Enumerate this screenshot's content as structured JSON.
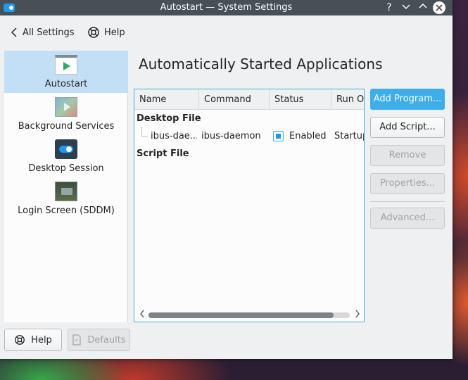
{
  "window": {
    "title": "Autostart  — System Settings",
    "buttons": {
      "help": "?",
      "minimize": "⌄",
      "maximize": "⌃",
      "close": "✕"
    }
  },
  "toolbar": {
    "back_label": "All Settings",
    "help_label": "Help"
  },
  "sidebar": {
    "items": [
      {
        "label": "Autostart",
        "icon": "autostart-icon",
        "selected": true
      },
      {
        "label": "Background Services",
        "icon": "background-services-icon",
        "selected": false
      },
      {
        "label": "Desktop Session",
        "icon": "desktop-session-icon",
        "selected": false
      },
      {
        "label": "Login Screen (SDDM)",
        "icon": "login-screen-icon",
        "selected": false
      }
    ]
  },
  "main": {
    "title": "Automatically Started Applications",
    "table": {
      "columns": [
        "Name",
        "Command",
        "Status",
        "Run On"
      ],
      "groups": [
        {
          "label": "Desktop File",
          "rows": [
            {
              "name": "ibus-dae...",
              "command": "ibus-daemon",
              "status": "Enabled",
              "enabled": true,
              "run_on": "Startup"
            }
          ]
        },
        {
          "label": "Script File",
          "rows": []
        }
      ],
      "scroll_position_fraction": 0.92
    },
    "buttons": {
      "add_program": "Add Program...",
      "add_script": "Add Script...",
      "remove": "Remove",
      "properties": "Properties...",
      "advanced": "Advanced..."
    }
  },
  "footer": {
    "help_label": "Help",
    "defaults_label": "Defaults"
  },
  "colors": {
    "accent": "#3daee9",
    "selection": "#c2dff5",
    "titlebar": "#475057"
  }
}
